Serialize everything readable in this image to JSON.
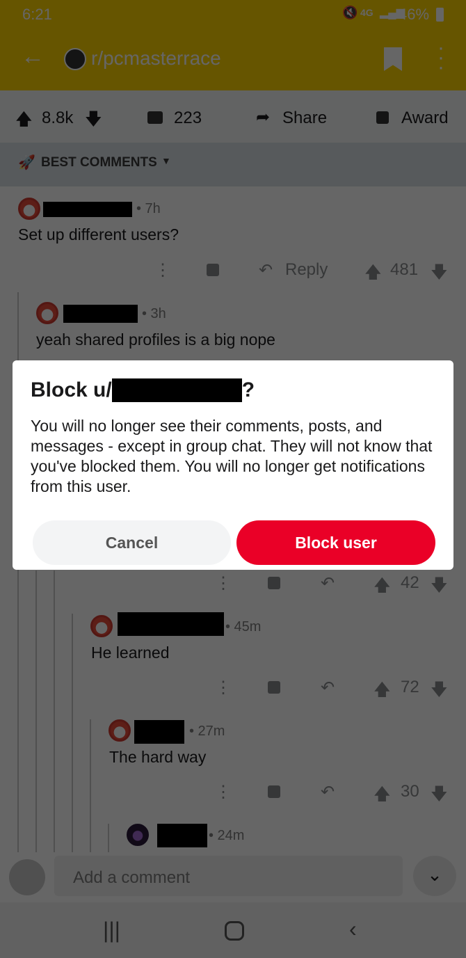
{
  "status_bar": {
    "time": "6:21",
    "network": "4G",
    "battery": "46%"
  },
  "header": {
    "subreddit": "r/pcmasterrace"
  },
  "post_stats": {
    "score": "8.8k",
    "comments": "223",
    "share": "Share",
    "award": "Award"
  },
  "sort": {
    "label": "BEST COMMENTS"
  },
  "comments": [
    {
      "time": "• 7h",
      "body": "Set up different users?",
      "reply": "Reply",
      "score": "481"
    },
    {
      "time": "• 3h",
      "body": "yeah shared profiles is a big nope"
    },
    {
      "score": "42"
    },
    {
      "time": "• 45m",
      "body": "He learned",
      "score": "72"
    },
    {
      "time": "• 27m",
      "body": "The hard way",
      "score": "30"
    },
    {
      "time": "• 24m"
    }
  ],
  "comment_bar": {
    "placeholder": "Add a comment"
  },
  "dialog": {
    "title_prefix": "Block u/",
    "title_suffix": "?",
    "message": "You will no longer see their comments, posts, and messages - except in group chat. They will not know that you've blocked them. You will no longer get notifications from this user.",
    "cancel": "Cancel",
    "confirm": "Block user",
    "confirm_color": "#ea0027"
  }
}
